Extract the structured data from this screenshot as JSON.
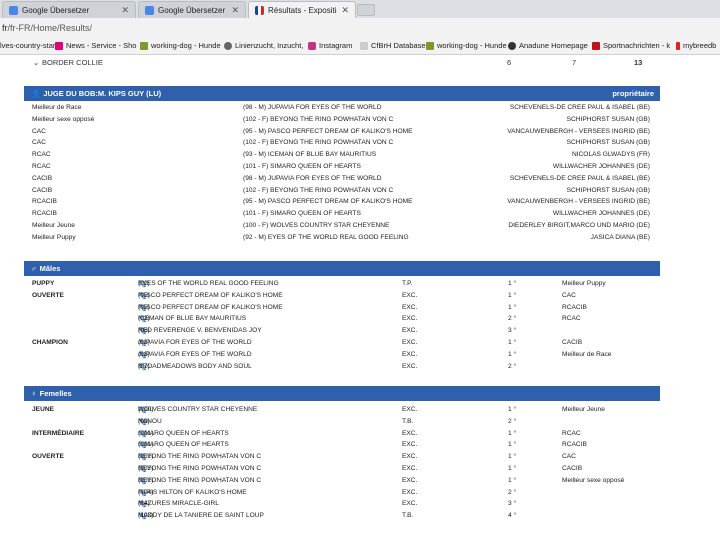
{
  "tabs": [
    {
      "title": "Google Übersetzer",
      "active": false
    },
    {
      "title": "Google Übersetzer",
      "active": false
    },
    {
      "title": "Résultats - Expositions Ca",
      "active": true
    }
  ],
  "address": {
    "host": "fr",
    "path": "/fr-FR/Home/Results/"
  },
  "bookmarks": [
    "lves-country-star",
    "News - Service - Sho",
    "working-dog - Hunde",
    "Linienzucht, Inzucht,",
    "Instagram",
    "CfBrH Database",
    "working-dog - Hunde",
    "Anadune Homepage",
    "Sportnachrichten - k",
    "mybreedb"
  ],
  "breed": {
    "name": "BORDER COLLIE",
    "c1": "6",
    "c2": "7",
    "c3": "13"
  },
  "judge": {
    "title": "JUGE DU BOB:M. KIPS GUY (LU)",
    "owner_label": "propriétaire",
    "rows": [
      {
        "award": "Meilleur de Race",
        "dog": "(98 - M) JUPAVIA FOR EYES OF THE WORLD",
        "owner": "SCHEVENELS-DE CREE PAUL & ISABEL (BE)"
      },
      {
        "award": "Meilleur sexe opposé",
        "dog": "(102 - F) BEYONG THE RING POWHATAN VON C",
        "owner": "SCHIPHORST SUSAN (GB)"
      },
      {
        "award": "CAC",
        "dog": "(95 - M) PASCO PERFECT DREAM OF KALIKO'S HOME",
        "owner": "VANCAUWENBERGH - VERSEES INGRID (BE)"
      },
      {
        "award": "CAC",
        "dog": "(102 - F) BEYONG THE RING POWHATAN VON C",
        "owner": "SCHIPHORST SUSAN (GB)"
      },
      {
        "award": "RCAC",
        "dog": "(93 - M) ICEMAN OF BLUE BAY MAURITIUS",
        "owner": "NICOLAS GLWADYS (FR)"
      },
      {
        "award": "RCAC",
        "dog": "(101 - F) SIMARO QUEEN OF HEARTS",
        "owner": "WILLWACHER JOHANNES (DE)"
      },
      {
        "award": "CACIB",
        "dog": "(98 - M) JUPAVIA FOR EYES OF THE WORLD",
        "owner": "SCHEVENELS-DE CREE PAUL & ISABEL (BE)"
      },
      {
        "award": "CACIB",
        "dog": "(102 - F) BEYONG THE RING POWHATAN VON C",
        "owner": "SCHIPHORST SUSAN (GB)"
      },
      {
        "award": "RCACIB",
        "dog": "(95 - M) PASCO PERFECT DREAM OF KALIKO'S HOME",
        "owner": "VANCAUWENBERGH - VERSEES INGRID (BE)"
      },
      {
        "award": "RCACIB",
        "dog": "(101 - F) SIMARO QUEEN OF HEARTS",
        "owner": "WILLWACHER JOHANNES (DE)"
      },
      {
        "award": "Meilleur Jeune",
        "dog": "(100 - F) WOLVES COUNTRY STAR CHEYENNE",
        "owner": "DIEDERLEY BIRGIT,MARCO UND MARIO (DE)"
      },
      {
        "award": "Meilleur Puppy",
        "dog": "(92 - M) EYES OF THE WORLD REAL GOOD FEELING",
        "owner": "JASICA DIANA (BE)"
      }
    ]
  },
  "males": {
    "title": "Mâles",
    "rows": [
      {
        "cls": "PUPPY",
        "dog": "EYES OF THE WORLD REAL GOOD FEELING",
        "num": "(92)",
        "q": "T.P.",
        "place": "1 °",
        "award": "Meilleur Puppy"
      },
      {
        "cls": "OUVERTE",
        "dog": "PASCO PERFECT DREAM OF KALIKO'S HOME",
        "num": "(95)",
        "q": "EXC.",
        "place": "1 °",
        "award": "CAC"
      },
      {
        "cls": "",
        "dog": "PASCO PERFECT DREAM OF KALIKO'S HOME",
        "num": "(95)",
        "q": "EXC.",
        "place": "1 °",
        "award": "RCACIB"
      },
      {
        "cls": "",
        "dog": "ICEMAN OF BLUE BAY MAURITIUS",
        "num": "(93)",
        "q": "EXC.",
        "place": "2 °",
        "award": "RCAC"
      },
      {
        "cls": "",
        "dog": "RED REVERENGE V. BENVENIDAS JOY",
        "num": "(96)",
        "q": "EXC.",
        "place": "3 °",
        "award": ""
      },
      {
        "cls": "CHAMPION",
        "dog": "JUPAVIA FOR EYES OF THE WORLD",
        "num": "(98)",
        "q": "EXC.",
        "place": "1 °",
        "award": "CACIB"
      },
      {
        "cls": "",
        "dog": "JUPAVIA FOR EYES OF THE WORLD",
        "num": "(98)",
        "q": "EXC.",
        "place": "1 °",
        "award": "Meilleur de Race"
      },
      {
        "cls": "",
        "dog": "BROADMEADOWS BODY AND SOUL",
        "num": "(97)",
        "q": "EXC.",
        "place": "2 °",
        "award": ""
      }
    ]
  },
  "females": {
    "title": "Femelles",
    "rows": [
      {
        "cls": "JEUNE",
        "dog": "WOLVES COUNTRY STAR CHEYENNE",
        "num": "(100)",
        "q": "EXC.",
        "place": "1 °",
        "award": "Meilleur Jeune"
      },
      {
        "cls": "",
        "dog": "NANOU",
        "num": "(99)",
        "q": "T.B.",
        "place": "2 °",
        "award": ""
      },
      {
        "cls": "INTERMÉDIAIRE",
        "dog": "SIMARO QUEEN OF HEARTS",
        "num": "(101)",
        "q": "EXC.",
        "place": "1 °",
        "award": "RCAC"
      },
      {
        "cls": "",
        "dog": "SIMARO QUEEN OF HEARTS",
        "num": "(101)",
        "q": "EXC.",
        "place": "1 °",
        "award": "RCACIB"
      },
      {
        "cls": "OUVERTE",
        "dog": "BEYONG THE RING POWHATAN VON C",
        "num": "(102)",
        "q": "EXC.",
        "place": "1 °",
        "award": "CAC"
      },
      {
        "cls": "",
        "dog": "BEYONG THE RING POWHATAN VON C",
        "num": "(102)",
        "q": "EXC.",
        "place": "1 °",
        "award": "CACIB"
      },
      {
        "cls": "",
        "dog": "BEYONG THE RING POWHATAN VON C",
        "num": "(102)",
        "q": "EXC.",
        "place": "1 °",
        "award": "Meilleur sexe opposé"
      },
      {
        "cls": "",
        "dog": "PARIS HILTON OF KALIKO'S HOME",
        "num": "(104)",
        "q": "EXC.",
        "place": "2 °",
        "award": ""
      },
      {
        "cls": "",
        "dog": "MAZURES MIRACLE-GIRL",
        "num": "(94)",
        "q": "EXC.",
        "place": "3 °",
        "award": ""
      },
      {
        "cls": "",
        "dog": "MADDY DE LA TANIERE DE SAINT LOUP",
        "num": "(103)",
        "q": "T.B.",
        "place": "4 °",
        "award": ""
      }
    ]
  }
}
